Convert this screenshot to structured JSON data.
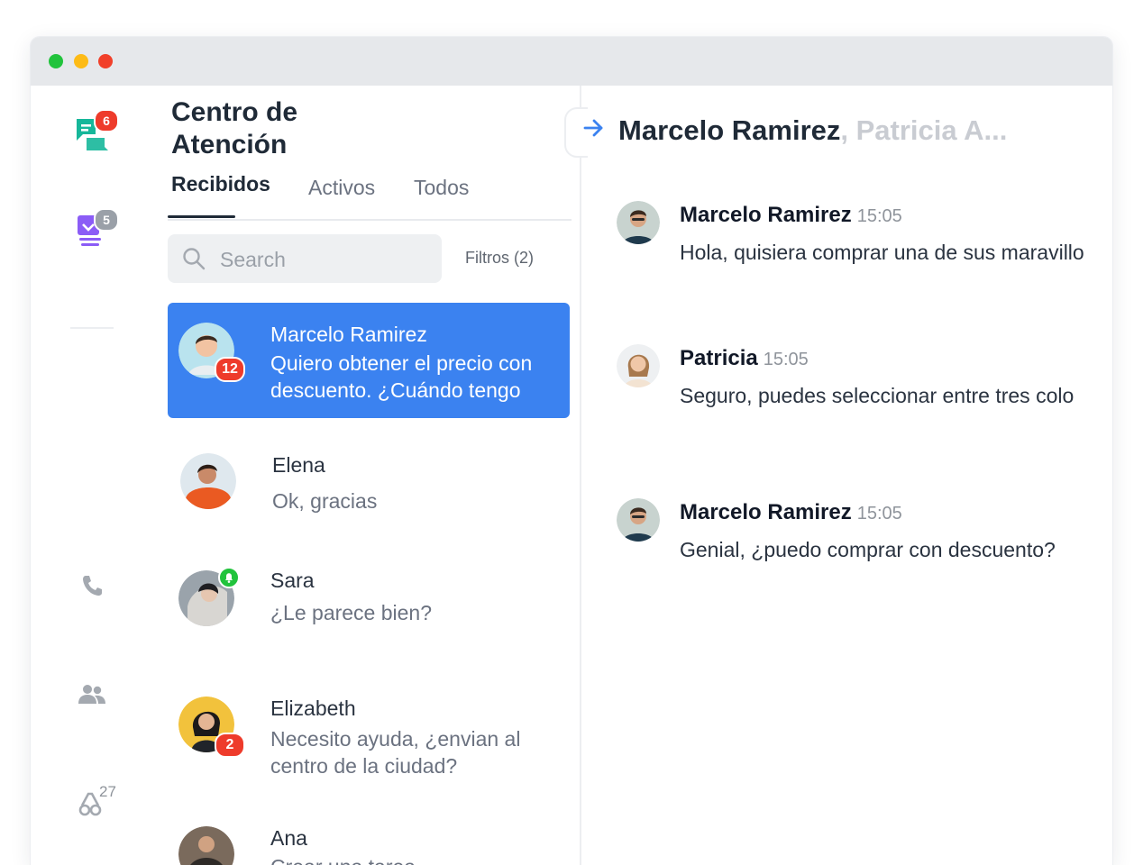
{
  "app": {
    "title": "Centro de Atención",
    "tabs": [
      {
        "label": "Recibidos",
        "active": true
      },
      {
        "label": "Activos",
        "active": false
      },
      {
        "label": "Todos",
        "active": false
      }
    ],
    "search": {
      "placeholder": "Search",
      "value": ""
    },
    "filters_label": "Filtros (2)"
  },
  "rail": {
    "chat_badge": "6",
    "inbox_badge": "5",
    "contacts_count": "27",
    "icons": [
      "chat-bubbles-icon",
      "inbox-tray-icon",
      "phone-icon",
      "people-icon",
      "team-icon"
    ]
  },
  "conversations": [
    {
      "name": "Marcelo Ramirez",
      "preview": "Quiero obtener el precio con descuento. ¿Cuándo tengo",
      "unread": "12",
      "active": true
    },
    {
      "name": "Elena",
      "preview": "Ok, gracias",
      "unread": "",
      "active": false
    },
    {
      "name": "Sara",
      "preview": "¿Le parece bien?",
      "unread": "",
      "active": false,
      "online": true
    },
    {
      "name": "Elizabeth",
      "preview": "Necesito ayuda, ¿envian al centro de la ciudad?",
      "unread": "2",
      "active": false
    },
    {
      "name": "Ana",
      "preview": "Crear una tarea",
      "unread": "",
      "active": false
    }
  ],
  "chat": {
    "title_primary": "Marcelo Ramirez",
    "title_secondary": ", Patricia A...",
    "messages": [
      {
        "author": "Marcelo Ramirez",
        "time": "15:05",
        "text": "Hola, quisiera comprar una de sus maravillo"
      },
      {
        "author": "Patricia",
        "time": "15:05",
        "text": "Seguro, puedes seleccionar entre tres colo"
      },
      {
        "author": "Marcelo Ramirez",
        "time": "15:05",
        "text": "Genial, ¿puedo comprar con descuento?"
      }
    ]
  },
  "colors": {
    "accent": "#3b82f0",
    "badge_red": "#ee3b2b",
    "chat_icon_green": "#16b79a",
    "inbox_icon_purple": "#8b5cf6",
    "online_green": "#21c33c"
  }
}
